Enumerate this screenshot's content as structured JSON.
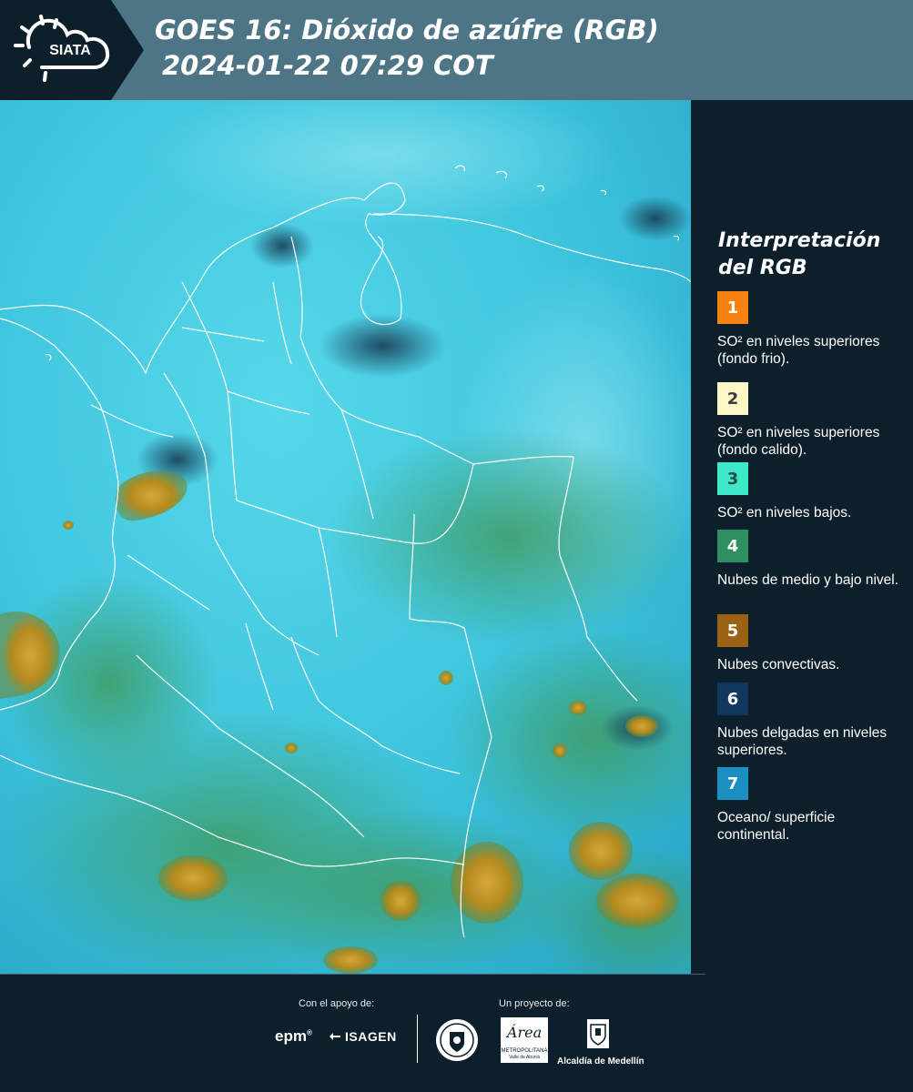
{
  "header": {
    "logo_text": "SIATA",
    "title_line1": "GOES 16: Dióxido de azúfre (RGB)",
    "title_line2": "2024-01-22 07:29 COT",
    "background_color": "#4e7585"
  },
  "map": {
    "ocean_color": "#3ac6de",
    "border_color": "#ffffff",
    "cloud_colors": {
      "convective": "#b8901a",
      "mid_low": "#4aa56a",
      "thin_high": "#1e4a6e"
    }
  },
  "legend": {
    "title": "Interpretación del RGB",
    "items": [
      {
        "number": "1",
        "color": "#f5820f",
        "number_color": "#ffffff",
        "text": "SO² en niveles superiores (fondo frio)."
      },
      {
        "number": "2",
        "color": "#fdf6c7",
        "number_color": "#3b3b3b",
        "text": "SO² en niveles superiores (fondo calido)."
      },
      {
        "number": "3",
        "color": "#3fe8c8",
        "number_color": "#2b4a4a",
        "text": "SO² en niveles bajos."
      },
      {
        "number": "4",
        "color": "#2f8f62",
        "number_color": "#ffffff",
        "text": "Nubes de medio y bajo nivel."
      },
      {
        "number": "5",
        "color": "#9a6212",
        "number_color": "#ffffff",
        "text": "Nubes convectivas."
      },
      {
        "number": "6",
        "color": "#11365f",
        "number_color": "#ffffff",
        "text": "Nubes delgadas en niveles superiores."
      },
      {
        "number": "7",
        "color": "#1b8fc2",
        "number_color": "#ffffff",
        "text": "Oceano/ superficie continental."
      }
    ]
  },
  "footer": {
    "support_caption": "Con el apoyo de:",
    "project_caption": "Un proyecto de:",
    "epm_label": "epm",
    "isagen_label": "ISAGEN",
    "area_label": "Área",
    "area_sublabel1": "METROPOLITANA",
    "area_sublabel2": "Valle de Aburrá",
    "alcaldia_label": "Alcaldía de Medellín"
  }
}
